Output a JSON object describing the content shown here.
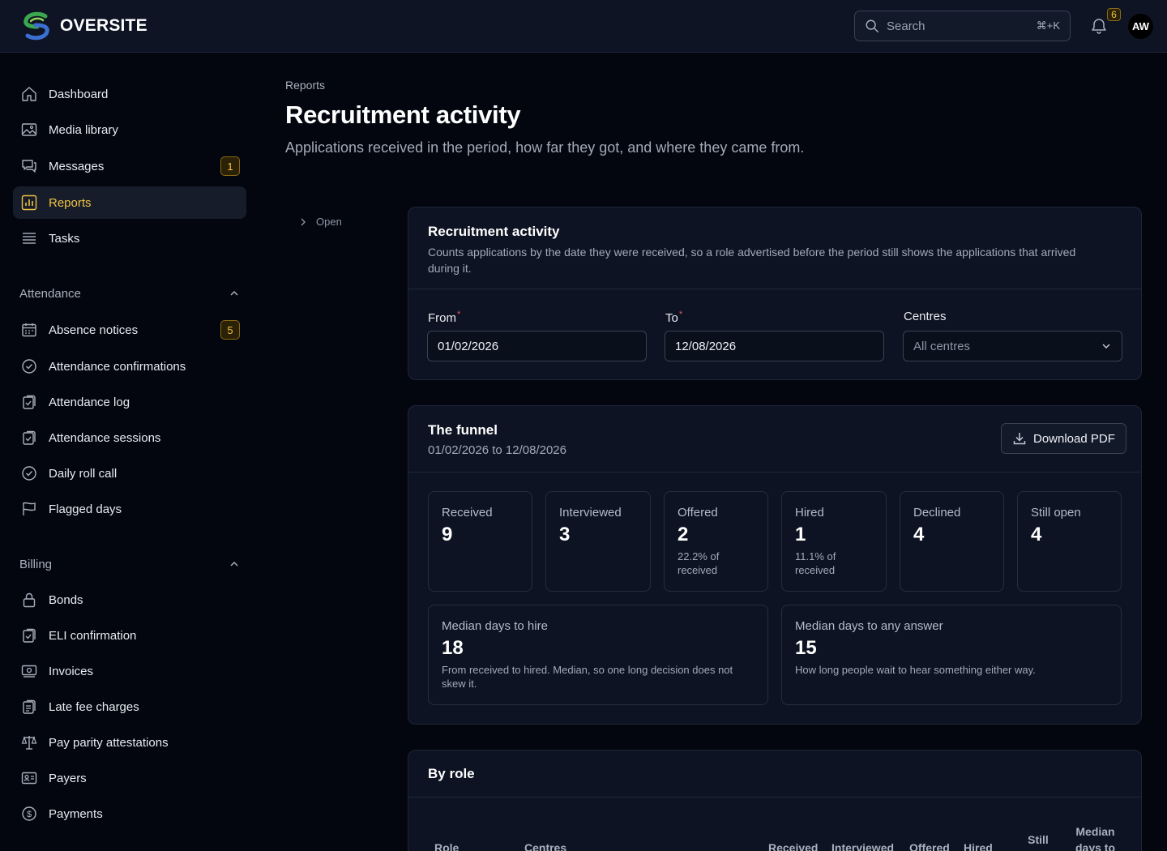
{
  "app": {
    "name": "OVERSITE"
  },
  "header": {
    "search_placeholder": "Search",
    "search_shortcut": "⌘+K",
    "notifications_count": "6",
    "avatar_initials": "AW"
  },
  "sidebar": {
    "main_items": [
      {
        "label": "Dashboard",
        "icon": "home-icon"
      },
      {
        "label": "Media library",
        "icon": "image-icon"
      },
      {
        "label": "Messages",
        "icon": "chat-icon",
        "badge": "1"
      },
      {
        "label": "Reports",
        "icon": "chart-icon",
        "active": true
      },
      {
        "label": "Tasks",
        "icon": "list-icon"
      }
    ],
    "attendance": {
      "label": "Attendance",
      "items": [
        {
          "label": "Absence notices",
          "icon": "calendar-icon",
          "badge": "5"
        },
        {
          "label": "Attendance confirmations",
          "icon": "check-circle-icon"
        },
        {
          "label": "Attendance log",
          "icon": "clipboard-check-icon"
        },
        {
          "label": "Attendance sessions",
          "icon": "clipboard-check-icon"
        },
        {
          "label": "Daily roll call",
          "icon": "check-circle-icon"
        },
        {
          "label": "Flagged days",
          "icon": "flag-icon"
        }
      ]
    },
    "billing": {
      "label": "Billing",
      "items": [
        {
          "label": "Bonds",
          "icon": "lock-icon"
        },
        {
          "label": "ELI confirmation",
          "icon": "clipboard-check-icon"
        },
        {
          "label": "Invoices",
          "icon": "banknote-icon"
        },
        {
          "label": "Late fee charges",
          "icon": "receipt-icon"
        },
        {
          "label": "Pay parity attestations",
          "icon": "scale-icon"
        },
        {
          "label": "Payers",
          "icon": "id-card-icon"
        },
        {
          "label": "Payments",
          "icon": "dollar-circle-icon"
        }
      ]
    }
  },
  "page": {
    "breadcrumb": "Reports",
    "title": "Recruitment activity",
    "subtitle": "Applications received in the period, how far they got, and where they came from.",
    "toggle_label": "Open"
  },
  "filters": {
    "title": "Recruitment activity",
    "description": "Counts applications by the date they were received, so a role advertised before the period still shows the applications that arrived during it.",
    "from_label": "From",
    "from_value": "01/02/2026",
    "to_label": "To",
    "to_value": "12/08/2026",
    "centres_label": "Centres",
    "centres_value": "All centres"
  },
  "funnel": {
    "title": "The funnel",
    "range": "01/02/2026 to 12/08/2026",
    "download_label": "Download PDF",
    "stats": [
      {
        "label": "Received",
        "value": "9",
        "note": ""
      },
      {
        "label": "Interviewed",
        "value": "3",
        "note": ""
      },
      {
        "label": "Offered",
        "value": "2",
        "note": "22.2% of received"
      },
      {
        "label": "Hired",
        "value": "1",
        "note": "11.1% of received"
      },
      {
        "label": "Declined",
        "value": "4",
        "note": ""
      },
      {
        "label": "Still open",
        "value": "4",
        "note": ""
      }
    ],
    "medians": [
      {
        "label": "Median days to hire",
        "value": "18",
        "note": "From received to hired. Median, so one long decision does not skew it."
      },
      {
        "label": "Median days to any answer",
        "value": "15",
        "note": "How long people wait to hear something either way."
      }
    ]
  },
  "by_role": {
    "title": "By role",
    "columns": [
      "Role",
      "Centres",
      "Received",
      "Interviewed",
      "Offered",
      "Hired",
      "Still open",
      "Median days to hire"
    ]
  },
  "colors": {
    "accent": "#f0c341",
    "logo_green": "#3aa84f",
    "logo_blue": "#3b6fd1",
    "background": "#03060f",
    "card": "#0d1322"
  }
}
